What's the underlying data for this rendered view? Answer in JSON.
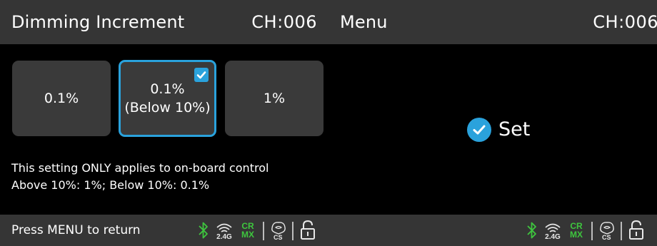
{
  "left_screen": {
    "title": "Dimming Increment",
    "channel": "CH:006",
    "options": [
      {
        "line1": "0.1%",
        "line2": "",
        "selected": false
      },
      {
        "line1": "0.1%",
        "line2": "(Below 10%)",
        "selected": true
      },
      {
        "line1": "1%",
        "line2": "",
        "selected": false
      }
    ],
    "info_line1": "This setting ONLY applies to on-board control",
    "info_line2": "Above 10%: 1%; Below 10%: 0.1%",
    "footer_hint": "Press MENU to return"
  },
  "right_screen": {
    "title": "Menu",
    "channel": "CH:006",
    "toast_label": "Set"
  },
  "status_icons": {
    "bluetooth": "bluetooth-icon",
    "wireless": "wireless-2.4g-icon",
    "wireless_text": "2.4G",
    "crmx": "crmx-icon",
    "crmx_top": "CR",
    "crmx_bottom": "MX",
    "ecos": "ecos-icon",
    "lock": "unlock-icon"
  },
  "colors": {
    "accent": "#2aa2dc",
    "bluetooth_green": "#3ec63e",
    "bar_bg": "#353535",
    "screen_bg": "#000000",
    "tile_bg": "#3a3a3a"
  }
}
